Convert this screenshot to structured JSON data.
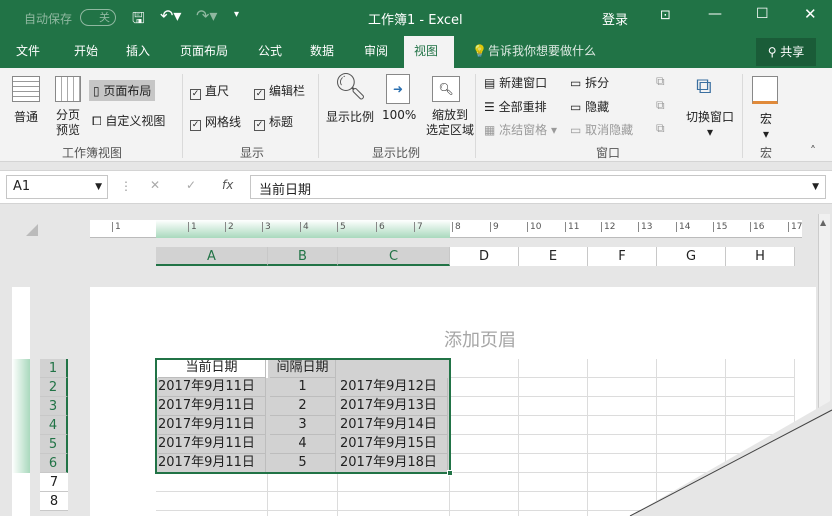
{
  "titlebar": {
    "autosave": "自动保存",
    "toggle": "关",
    "title": "工作簿1  -  Excel",
    "login": "登录"
  },
  "tabs": [
    "文件",
    "开始",
    "插入",
    "页面布局",
    "公式",
    "数据",
    "审阅",
    "视图"
  ],
  "active_tab": "视图",
  "tellme": "告诉我你想要做什么",
  "share": "共享",
  "ribbon": {
    "workbook_views": {
      "normal": "普通",
      "page_break": "分页\n预览",
      "page_layout": "页面布局",
      "custom": "自定义视图",
      "group": "工作簿视图"
    },
    "show": {
      "ruler": "直尺",
      "formula_bar": "编辑栏",
      "gridlines": "网格线",
      "headings": "标题",
      "group": "显示"
    },
    "zoom": {
      "zoom": "显示比例",
      "100": "100%",
      "zoom_sel1": "缩放到",
      "zoom_sel2": "选定区域",
      "group": "显示比例"
    },
    "window": {
      "new": "新建窗口",
      "arrange": "全部重排",
      "freeze": "冻结窗格",
      "split": "拆分",
      "hide": "隐藏",
      "unhide": "取消隐藏",
      "switch": "切换窗口",
      "group": "窗口"
    },
    "macros": {
      "macros": "宏",
      "group": "宏"
    }
  },
  "formula": {
    "namebox": "A1",
    "fx": "fx",
    "content": "当前日期"
  },
  "ruler_top": [
    "1",
    "1",
    "2",
    "3",
    "4",
    "5",
    "6",
    "7",
    "8",
    "9",
    "10",
    "11",
    "12",
    "13",
    "14",
    "15",
    "16",
    "17"
  ],
  "columns": [
    "A",
    "B",
    "C",
    "D",
    "E",
    "F",
    "G",
    "H"
  ],
  "rows": [
    "1",
    "2",
    "3",
    "4",
    "5",
    "6",
    "7",
    "8"
  ],
  "header_placeholder": "添加页眉",
  "table": [
    [
      "当前日期",
      "间隔日期",
      ""
    ],
    [
      "2017年9月11日",
      "1",
      "2017年9月12日"
    ],
    [
      "2017年9月11日",
      "2",
      "2017年9月13日"
    ],
    [
      "2017年9月11日",
      "3",
      "2017年9月14日"
    ],
    [
      "2017年9月11日",
      "4",
      "2017年9月15日"
    ],
    [
      "2017年9月11日",
      "5",
      "2017年9月18日"
    ]
  ],
  "colors": {
    "accent": "#217346",
    "selection": "#d2d2d2"
  }
}
